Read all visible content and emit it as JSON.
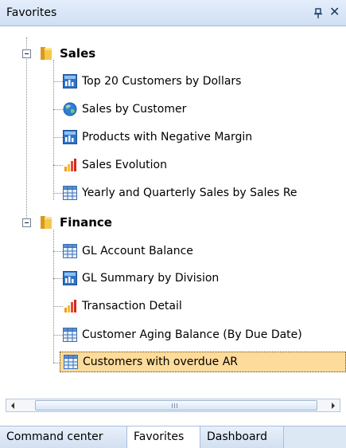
{
  "header": {
    "title": "Favorites"
  },
  "tree": {
    "folders": [
      {
        "label": "Sales",
        "reports": [
          {
            "label": "Top 20 Customers by Dollars",
            "icon": "chart-report-icon"
          },
          {
            "label": "Sales by Customer",
            "icon": "globe-map-icon"
          },
          {
            "label": "Products with Negative Margin",
            "icon": "chart-report-icon"
          },
          {
            "label": "Sales Evolution",
            "icon": "bar-chart-icon"
          },
          {
            "label": "Yearly and Quarterly Sales by Sales Re",
            "icon": "grid-table-icon"
          }
        ]
      },
      {
        "label": "Finance",
        "reports": [
          {
            "label": "GL Account Balance",
            "icon": "grid-table-icon"
          },
          {
            "label": "GL Summary by Division",
            "icon": "chart-report-icon"
          },
          {
            "label": "Transaction Detail",
            "icon": "bar-chart-icon"
          },
          {
            "label": "Customer Aging Balance (By Due Date)",
            "icon": "grid-table-icon"
          },
          {
            "label": "Customers with overdue AR",
            "icon": "grid-table-icon",
            "selected": true
          }
        ]
      }
    ]
  },
  "tabs": [
    {
      "label": "Command center"
    },
    {
      "label": "Favorites",
      "active": true
    },
    {
      "label": "Dashboard"
    }
  ],
  "colors": {
    "header_bg": "#d6e4f5",
    "selection": "#fddb9a",
    "tab_strip": "#dde8f5",
    "folder": "#f3c24a"
  }
}
